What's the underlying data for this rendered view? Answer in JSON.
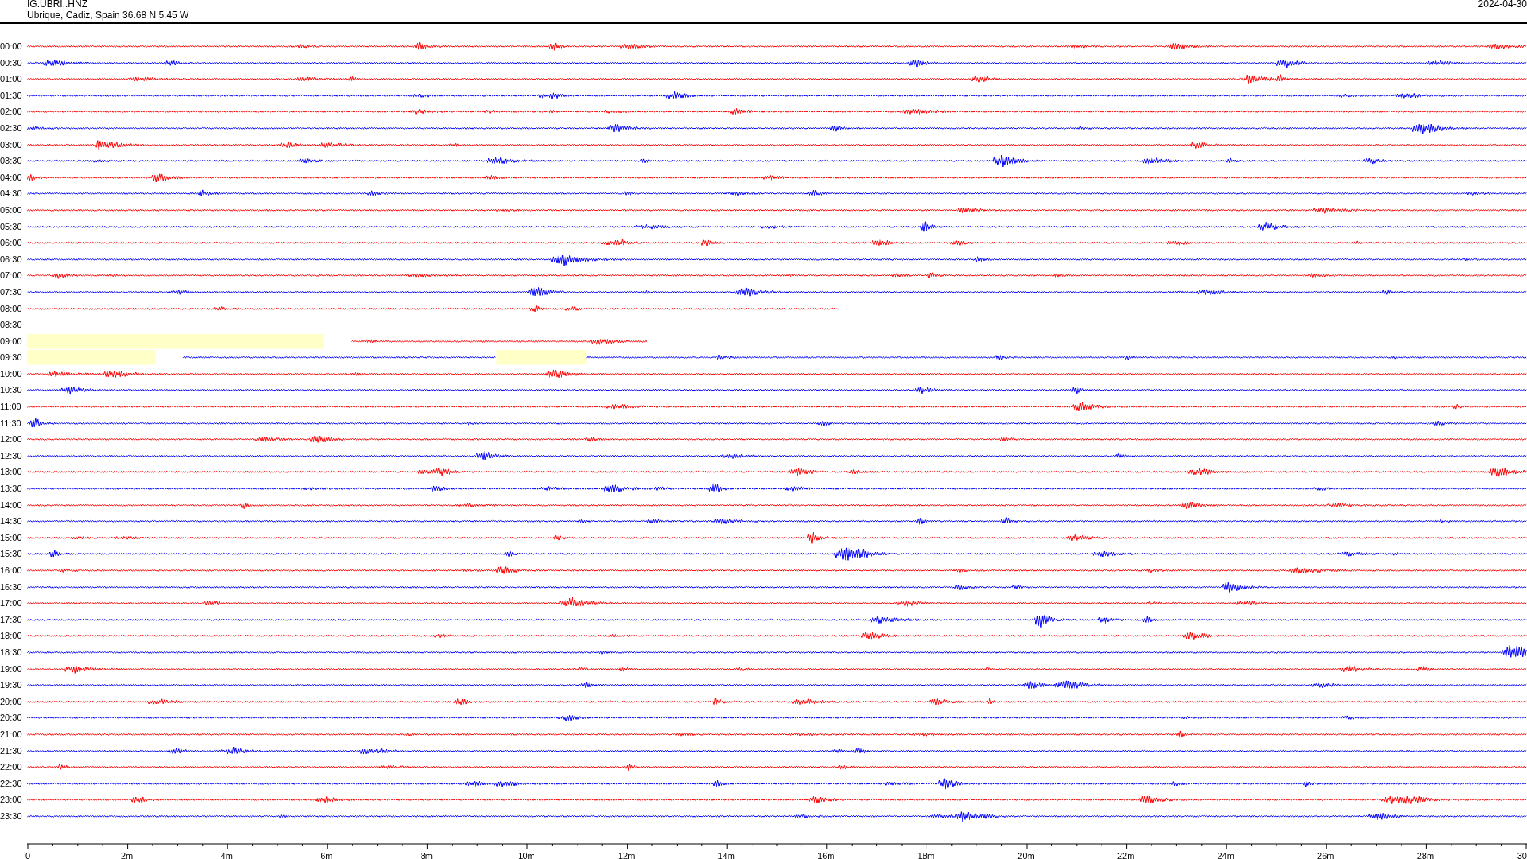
{
  "header": {
    "station": "IG.UBRI..HNZ",
    "location": "Ubrique, Cadiz, Spain  36.68 N 5.45 W",
    "date": "2024-04-30"
  },
  "rows": [
    {
      "time": "00:00",
      "color": "#ff0000",
      "kind": "full"
    },
    {
      "time": "00:30",
      "color": "#0000ff",
      "kind": "full"
    },
    {
      "time": "01:00",
      "color": "#ff0000",
      "kind": "full"
    },
    {
      "time": "01:30",
      "color": "#0000ff",
      "kind": "full"
    },
    {
      "time": "02:00",
      "color": "#ff0000",
      "kind": "full"
    },
    {
      "time": "02:30",
      "color": "#0000ff",
      "kind": "full"
    },
    {
      "time": "03:00",
      "color": "#ff0000",
      "kind": "full"
    },
    {
      "time": "03:30",
      "color": "#0000ff",
      "kind": "full"
    },
    {
      "time": "04:00",
      "color": "#ff0000",
      "kind": "full"
    },
    {
      "time": "04:30",
      "color": "#0000ff",
      "kind": "full"
    },
    {
      "time": "05:00",
      "color": "#ff0000",
      "kind": "full"
    },
    {
      "time": "05:30",
      "color": "#0000ff",
      "kind": "full"
    },
    {
      "time": "06:00",
      "color": "#ff0000",
      "kind": "full"
    },
    {
      "time": "06:30",
      "color": "#0000ff",
      "kind": "full"
    },
    {
      "time": "07:00",
      "color": "#ff0000",
      "kind": "full"
    },
    {
      "time": "07:30",
      "color": "#0000ff",
      "kind": "full"
    },
    {
      "time": "08:00",
      "color": "#ff0000",
      "kind": "partial",
      "level": 0.541
    },
    {
      "time": "08:30",
      "kind": "empty"
    },
    {
      "time": "09:00",
      "color": "#ff0000",
      "kind": "gap_head"
    },
    {
      "time": "09:30",
      "color": "#0000ff",
      "kind": "gap_split"
    },
    {
      "time": "10:00",
      "color": "#ff0000",
      "kind": "full"
    },
    {
      "time": "10:30",
      "color": "#0000ff",
      "kind": "full"
    },
    {
      "time": "11:00",
      "color": "#ff0000",
      "kind": "full"
    },
    {
      "time": "11:30",
      "color": "#0000ff",
      "kind": "full"
    },
    {
      "time": "12:00",
      "color": "#ff0000",
      "kind": "full"
    },
    {
      "time": "12:30",
      "color": "#0000ff",
      "kind": "full"
    },
    {
      "time": "13:00",
      "color": "#ff0000",
      "kind": "full"
    },
    {
      "time": "13:30",
      "color": "#0000ff",
      "kind": "full"
    },
    {
      "time": "14:00",
      "color": "#ff0000",
      "kind": "full"
    },
    {
      "time": "14:30",
      "color": "#0000ff",
      "kind": "full"
    },
    {
      "time": "15:00",
      "color": "#ff0000",
      "kind": "full"
    },
    {
      "time": "15:30",
      "color": "#0000ff",
      "kind": "full"
    },
    {
      "time": "16:00",
      "color": "#ff0000",
      "kind": "full"
    },
    {
      "time": "16:30",
      "color": "#0000ff",
      "kind": "full"
    },
    {
      "time": "17:00",
      "color": "#ff0000",
      "kind": "full"
    },
    {
      "time": "17:30",
      "color": "#0000ff",
      "kind": "full"
    },
    {
      "time": "18:00",
      "color": "#ff0000",
      "kind": "full"
    },
    {
      "time": "18:30",
      "color": "#0000ff",
      "kind": "full"
    },
    {
      "time": "19:00",
      "color": "#ff0000",
      "kind": "full"
    },
    {
      "time": "19:30",
      "color": "#0000ff",
      "kind": "full"
    },
    {
      "time": "20:00",
      "color": "#ff0000",
      "kind": "full"
    },
    {
      "time": "20:30",
      "color": "#0000ff",
      "kind": "full"
    },
    {
      "time": "21:00",
      "color": "#ff0000",
      "kind": "full"
    },
    {
      "time": "21:30",
      "color": "#0000ff",
      "kind": "full"
    },
    {
      "time": "22:00",
      "color": "#ff0000",
      "kind": "full"
    },
    {
      "time": "22:30",
      "color": "#0000ff",
      "kind": "full"
    },
    {
      "time": "23:00",
      "color": "#ff0000",
      "kind": "full"
    },
    {
      "time": "23:30",
      "color": "#0000ff",
      "kind": "full"
    }
  ],
  "x_axis": {
    "labels": [
      "0",
      "2m",
      "4m",
      "6m",
      "8m",
      "10m",
      "12m",
      "14m",
      "16m",
      "18m",
      "20m",
      "22m",
      "24m",
      "26m",
      "28m",
      "30"
    ]
  }
}
